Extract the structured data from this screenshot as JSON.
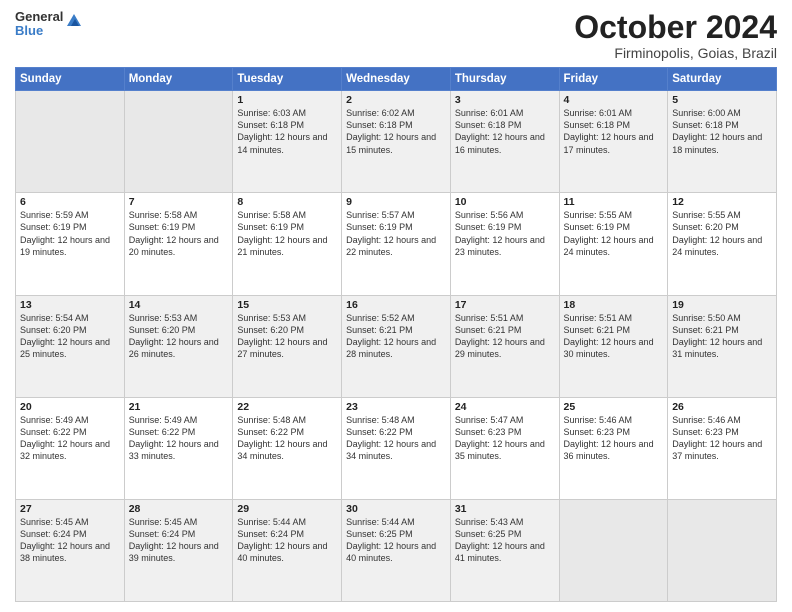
{
  "logo": {
    "general": "General",
    "blue": "Blue"
  },
  "title": {
    "month_year": "October 2024",
    "location": "Firminopolis, Goias, Brazil"
  },
  "days_of_week": [
    "Sunday",
    "Monday",
    "Tuesday",
    "Wednesday",
    "Thursday",
    "Friday",
    "Saturday"
  ],
  "weeks": [
    [
      {
        "day": "",
        "sunrise": "",
        "sunset": "",
        "daylight": "",
        "empty": true
      },
      {
        "day": "",
        "sunrise": "",
        "sunset": "",
        "daylight": "",
        "empty": true
      },
      {
        "day": "1",
        "sunrise": "Sunrise: 6:03 AM",
        "sunset": "Sunset: 6:18 PM",
        "daylight": "Daylight: 12 hours and 14 minutes.",
        "empty": false
      },
      {
        "day": "2",
        "sunrise": "Sunrise: 6:02 AM",
        "sunset": "Sunset: 6:18 PM",
        "daylight": "Daylight: 12 hours and 15 minutes.",
        "empty": false
      },
      {
        "day": "3",
        "sunrise": "Sunrise: 6:01 AM",
        "sunset": "Sunset: 6:18 PM",
        "daylight": "Daylight: 12 hours and 16 minutes.",
        "empty": false
      },
      {
        "day": "4",
        "sunrise": "Sunrise: 6:01 AM",
        "sunset": "Sunset: 6:18 PM",
        "daylight": "Daylight: 12 hours and 17 minutes.",
        "empty": false
      },
      {
        "day": "5",
        "sunrise": "Sunrise: 6:00 AM",
        "sunset": "Sunset: 6:18 PM",
        "daylight": "Daylight: 12 hours and 18 minutes.",
        "empty": false
      }
    ],
    [
      {
        "day": "6",
        "sunrise": "Sunrise: 5:59 AM",
        "sunset": "Sunset: 6:19 PM",
        "daylight": "Daylight: 12 hours and 19 minutes.",
        "empty": false
      },
      {
        "day": "7",
        "sunrise": "Sunrise: 5:58 AM",
        "sunset": "Sunset: 6:19 PM",
        "daylight": "Daylight: 12 hours and 20 minutes.",
        "empty": false
      },
      {
        "day": "8",
        "sunrise": "Sunrise: 5:58 AM",
        "sunset": "Sunset: 6:19 PM",
        "daylight": "Daylight: 12 hours and 21 minutes.",
        "empty": false
      },
      {
        "day": "9",
        "sunrise": "Sunrise: 5:57 AM",
        "sunset": "Sunset: 6:19 PM",
        "daylight": "Daylight: 12 hours and 22 minutes.",
        "empty": false
      },
      {
        "day": "10",
        "sunrise": "Sunrise: 5:56 AM",
        "sunset": "Sunset: 6:19 PM",
        "daylight": "Daylight: 12 hours and 23 minutes.",
        "empty": false
      },
      {
        "day": "11",
        "sunrise": "Sunrise: 5:55 AM",
        "sunset": "Sunset: 6:19 PM",
        "daylight": "Daylight: 12 hours and 24 minutes.",
        "empty": false
      },
      {
        "day": "12",
        "sunrise": "Sunrise: 5:55 AM",
        "sunset": "Sunset: 6:20 PM",
        "daylight": "Daylight: 12 hours and 24 minutes.",
        "empty": false
      }
    ],
    [
      {
        "day": "13",
        "sunrise": "Sunrise: 5:54 AM",
        "sunset": "Sunset: 6:20 PM",
        "daylight": "Daylight: 12 hours and 25 minutes.",
        "empty": false
      },
      {
        "day": "14",
        "sunrise": "Sunrise: 5:53 AM",
        "sunset": "Sunset: 6:20 PM",
        "daylight": "Daylight: 12 hours and 26 minutes.",
        "empty": false
      },
      {
        "day": "15",
        "sunrise": "Sunrise: 5:53 AM",
        "sunset": "Sunset: 6:20 PM",
        "daylight": "Daylight: 12 hours and 27 minutes.",
        "empty": false
      },
      {
        "day": "16",
        "sunrise": "Sunrise: 5:52 AM",
        "sunset": "Sunset: 6:21 PM",
        "daylight": "Daylight: 12 hours and 28 minutes.",
        "empty": false
      },
      {
        "day": "17",
        "sunrise": "Sunrise: 5:51 AM",
        "sunset": "Sunset: 6:21 PM",
        "daylight": "Daylight: 12 hours and 29 minutes.",
        "empty": false
      },
      {
        "day": "18",
        "sunrise": "Sunrise: 5:51 AM",
        "sunset": "Sunset: 6:21 PM",
        "daylight": "Daylight: 12 hours and 30 minutes.",
        "empty": false
      },
      {
        "day": "19",
        "sunrise": "Sunrise: 5:50 AM",
        "sunset": "Sunset: 6:21 PM",
        "daylight": "Daylight: 12 hours and 31 minutes.",
        "empty": false
      }
    ],
    [
      {
        "day": "20",
        "sunrise": "Sunrise: 5:49 AM",
        "sunset": "Sunset: 6:22 PM",
        "daylight": "Daylight: 12 hours and 32 minutes.",
        "empty": false
      },
      {
        "day": "21",
        "sunrise": "Sunrise: 5:49 AM",
        "sunset": "Sunset: 6:22 PM",
        "daylight": "Daylight: 12 hours and 33 minutes.",
        "empty": false
      },
      {
        "day": "22",
        "sunrise": "Sunrise: 5:48 AM",
        "sunset": "Sunset: 6:22 PM",
        "daylight": "Daylight: 12 hours and 34 minutes.",
        "empty": false
      },
      {
        "day": "23",
        "sunrise": "Sunrise: 5:48 AM",
        "sunset": "Sunset: 6:22 PM",
        "daylight": "Daylight: 12 hours and 34 minutes.",
        "empty": false
      },
      {
        "day": "24",
        "sunrise": "Sunrise: 5:47 AM",
        "sunset": "Sunset: 6:23 PM",
        "daylight": "Daylight: 12 hours and 35 minutes.",
        "empty": false
      },
      {
        "day": "25",
        "sunrise": "Sunrise: 5:46 AM",
        "sunset": "Sunset: 6:23 PM",
        "daylight": "Daylight: 12 hours and 36 minutes.",
        "empty": false
      },
      {
        "day": "26",
        "sunrise": "Sunrise: 5:46 AM",
        "sunset": "Sunset: 6:23 PM",
        "daylight": "Daylight: 12 hours and 37 minutes.",
        "empty": false
      }
    ],
    [
      {
        "day": "27",
        "sunrise": "Sunrise: 5:45 AM",
        "sunset": "Sunset: 6:24 PM",
        "daylight": "Daylight: 12 hours and 38 minutes.",
        "empty": false
      },
      {
        "day": "28",
        "sunrise": "Sunrise: 5:45 AM",
        "sunset": "Sunset: 6:24 PM",
        "daylight": "Daylight: 12 hours and 39 minutes.",
        "empty": false
      },
      {
        "day": "29",
        "sunrise": "Sunrise: 5:44 AM",
        "sunset": "Sunset: 6:24 PM",
        "daylight": "Daylight: 12 hours and 40 minutes.",
        "empty": false
      },
      {
        "day": "30",
        "sunrise": "Sunrise: 5:44 AM",
        "sunset": "Sunset: 6:25 PM",
        "daylight": "Daylight: 12 hours and 40 minutes.",
        "empty": false
      },
      {
        "day": "31",
        "sunrise": "Sunrise: 5:43 AM",
        "sunset": "Sunset: 6:25 PM",
        "daylight": "Daylight: 12 hours and 41 minutes.",
        "empty": false
      },
      {
        "day": "",
        "sunrise": "",
        "sunset": "",
        "daylight": "",
        "empty": true
      },
      {
        "day": "",
        "sunrise": "",
        "sunset": "",
        "daylight": "",
        "empty": true
      }
    ]
  ]
}
